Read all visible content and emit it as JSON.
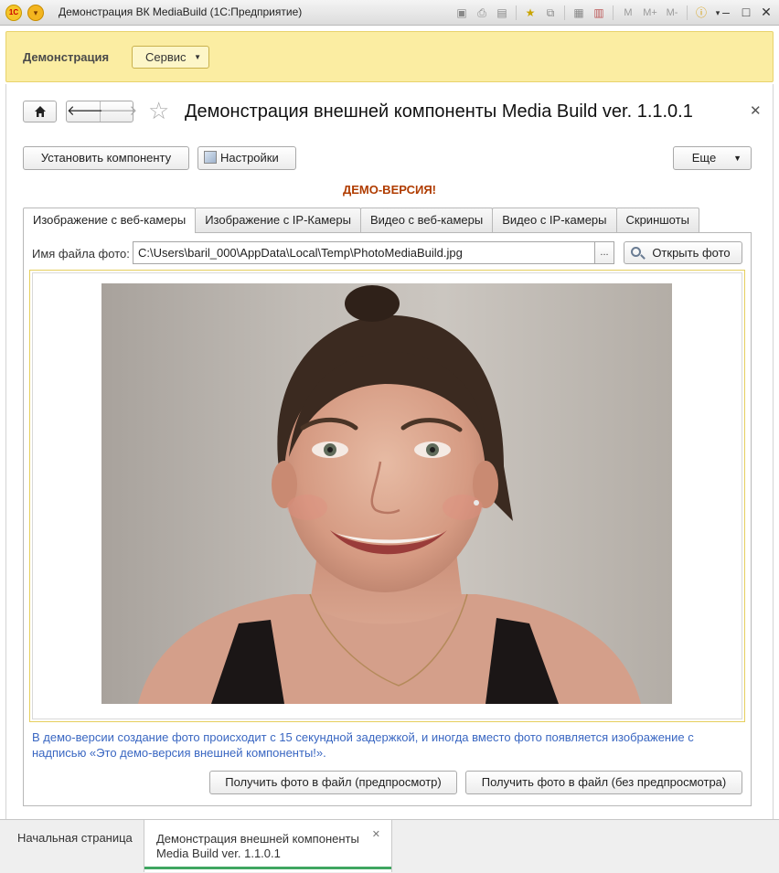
{
  "window": {
    "title": "Демонстрация ВК MediaBuild  (1С:Предприятие)",
    "logo": "1С",
    "toolbar_letters": [
      "M",
      "M+",
      "M-"
    ]
  },
  "section": {
    "title": "Демонстрация",
    "service_button": "Сервис"
  },
  "form": {
    "title": "Демонстрация внешней компоненты Media Build ver. 1.1.0.1",
    "install_button": "Установить компоненту",
    "settings_button": "Настройки",
    "more_button": "Еще",
    "demo_label": "ДЕМО-ВЕРСИЯ!"
  },
  "tabs": [
    {
      "label": "Изображение с веб-камеры",
      "active": true
    },
    {
      "label": "Изображение с IP-Камеры",
      "active": false
    },
    {
      "label": "Видео с веб-камеры",
      "active": false
    },
    {
      "label": "Видео с IP-камеры",
      "active": false
    },
    {
      "label": "Скриншоты",
      "active": false
    }
  ],
  "photo_panel": {
    "file_label": "Имя файла фото:",
    "file_value": "C:\\Users\\baril_000\\AppData\\Local\\Temp\\PhotoMediaBuild.jpg",
    "pick_button": "...",
    "open_button": "Открыть фото",
    "info_text": "В демо-версии создание фото происходит с 15 секундной задержкой, и иногда вместо фото появляется изображение с надписью «Это демо-версия внешней компоненты!».",
    "preview_button": "Получить фото в файл (предпросмотр)",
    "no_preview_button": "Получить фото в файл (без предпросмотра)"
  },
  "bottom_bar": {
    "home": "Начальная страница",
    "window_line1": "Демонстрация внешней компоненты",
    "window_line2": "Media Build ver. 1.1.0.1"
  },
  "colors": {
    "section_bg": "#fbeda2",
    "demo_label": "#b03c00",
    "info_text": "#3a67c2",
    "active_window_underline": "#3fa661"
  }
}
